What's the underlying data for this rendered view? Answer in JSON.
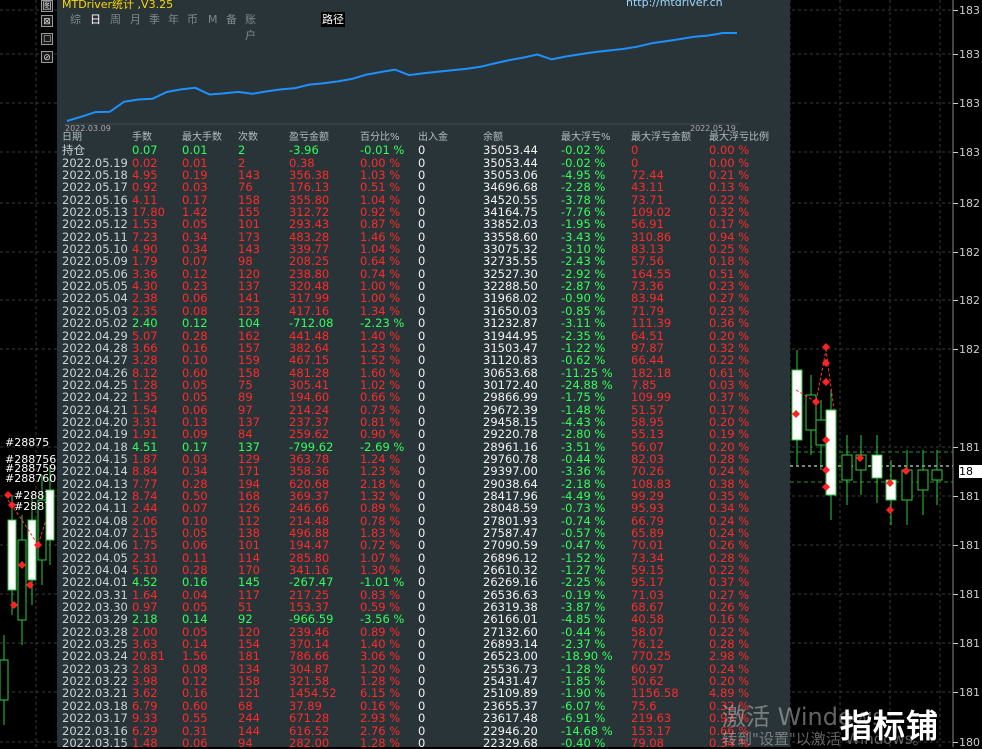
{
  "panel": {
    "title": "MTDriver统计 ,V3.25",
    "url": "http://mtdriver.cn",
    "tabs": [
      "综",
      "日",
      "周",
      "月",
      "季",
      "年",
      "币",
      "M",
      "备",
      "账户"
    ],
    "active_tab": "日",
    "path_button": "路径",
    "side_buttons": [
      "图",
      "⊠",
      "☐",
      "⊘"
    ]
  },
  "curve": {
    "start_date": "2022.03.09",
    "end_date": "2022.05.19",
    "color": "#1e90ff",
    "equity": [
      22329.68,
      22946.2,
      23617.48,
      23655.37,
      25109.89,
      25431.47,
      25536.73,
      26523.0,
      26893.14,
      27132.6,
      26166.01,
      26319.38,
      26536.63,
      26269.16,
      26610.32,
      26896.12,
      27090.59,
      27587.47,
      27801.93,
      28048.59,
      28417.96,
      29038.64,
      29397.0,
      29760.78,
      28961.16,
      29220.78,
      29458.15,
      29672.39,
      29866.99,
      30172.4,
      30653.68,
      31120.83,
      31503.47,
      31944.95,
      31232.87,
      31650.03,
      31968.02,
      32288.5,
      32527.3,
      32735.55,
      33075.32,
      33558.6,
      33852.03,
      34164.75,
      34520.55,
      34696.68,
      35053.06,
      35053.44
    ]
  },
  "table": {
    "headers": [
      "日期",
      "手数",
      "最大手数",
      "次数",
      "盈亏金额",
      "百分比%",
      "出入金",
      "余额",
      "最大浮亏%",
      "最大浮亏金额",
      "最大浮亏比例"
    ],
    "rows": [
      [
        "持仓",
        "0.07",
        "0.01",
        "2",
        "-3.96",
        "-0.01 %",
        "0",
        "35053.44",
        "-0.02 %",
        "0",
        "0.00 %"
      ],
      [
        "2022.05.19",
        "0.02",
        "0.01",
        "2",
        "0.38",
        "0.00 %",
        "0",
        "35053.44",
        "-0.02 %",
        "0",
        "0.00 %"
      ],
      [
        "2022.05.18",
        "4.95",
        "0.19",
        "143",
        "356.38",
        "1.03 %",
        "0",
        "35053.06",
        "-4.95 %",
        "72.44",
        "0.21 %"
      ],
      [
        "2022.05.17",
        "0.92",
        "0.03",
        "76",
        "176.13",
        "0.51 %",
        "0",
        "34696.68",
        "-2.28 %",
        "43.11",
        "0.13 %"
      ],
      [
        "2022.05.16",
        "4.11",
        "0.17",
        "158",
        "355.80",
        "1.04 %",
        "0",
        "34520.55",
        "-3.78 %",
        "73.71",
        "0.22 %"
      ],
      [
        "2022.05.13",
        "17.80",
        "1.42",
        "155",
        "312.72",
        "0.92 %",
        "0",
        "34164.75",
        "-7.76 %",
        "109.02",
        "0.32 %"
      ],
      [
        "2022.05.12",
        "1.53",
        "0.05",
        "101",
        "293.43",
        "0.87 %",
        "0",
        "33852.03",
        "-1.95 %",
        "56.91",
        "0.17 %"
      ],
      [
        "2022.05.11",
        "7.23",
        "0.34",
        "173",
        "483.28",
        "1.46 %",
        "0",
        "33558.60",
        "-3.43 %",
        "310.86",
        "0.94 %"
      ],
      [
        "2022.05.10",
        "4.90",
        "0.34",
        "143",
        "339.77",
        "1.04 %",
        "0",
        "33075.32",
        "-3.10 %",
        "83.13",
        "0.25 %"
      ],
      [
        "2022.05.09",
        "1.79",
        "0.07",
        "98",
        "208.25",
        "0.64 %",
        "0",
        "32735.55",
        "-2.43 %",
        "57.56",
        "0.18 %"
      ],
      [
        "2022.05.06",
        "3.36",
        "0.12",
        "120",
        "238.80",
        "0.74 %",
        "0",
        "32527.30",
        "-2.92 %",
        "164.55",
        "0.51 %"
      ],
      [
        "2022.05.05",
        "4.30",
        "0.23",
        "137",
        "320.48",
        "1.00 %",
        "0",
        "32288.50",
        "-2.87 %",
        "73.36",
        "0.23 %"
      ],
      [
        "2022.05.04",
        "2.38",
        "0.06",
        "141",
        "317.99",
        "1.00 %",
        "0",
        "31968.02",
        "-0.90 %",
        "83.94",
        "0.27 %"
      ],
      [
        "2022.05.03",
        "2.35",
        "0.08",
        "123",
        "417.16",
        "1.34 %",
        "0",
        "31650.03",
        "-0.85 %",
        "71.79",
        "0.23 %"
      ],
      [
        "2022.05.02",
        "2.40",
        "0.12",
        "104",
        "-712.08",
        "-2.23 %",
        "0",
        "31232.87",
        "-3.11 %",
        "111.39",
        "0.36 %"
      ],
      [
        "2022.04.29",
        "5.07",
        "0.28",
        "162",
        "441.48",
        "1.40 %",
        "0",
        "31944.95",
        "-2.35 %",
        "64.51",
        "0.20 %"
      ],
      [
        "2022.04.28",
        "3.66",
        "0.16",
        "157",
        "382.64",
        "1.23 %",
        "0",
        "31503.47",
        "-1.22 %",
        "97.87",
        "0.32 %"
      ],
      [
        "2022.04.27",
        "3.28",
        "0.10",
        "159",
        "467.15",
        "1.52 %",
        "0",
        "31120.83",
        "-0.62 %",
        "66.44",
        "0.22 %"
      ],
      [
        "2022.04.26",
        "8.12",
        "0.60",
        "158",
        "481.28",
        "1.60 %",
        "0",
        "30653.68",
        "-11.25 %",
        "182.18",
        "0.61 %"
      ],
      [
        "2022.04.25",
        "1.28",
        "0.05",
        "75",
        "305.41",
        "1.02 %",
        "0",
        "30172.40",
        "-24.88 %",
        "7.85",
        "0.03 %"
      ],
      [
        "2022.04.22",
        "1.35",
        "0.05",
        "89",
        "194.60",
        "0.66 %",
        "0",
        "29866.99",
        "-1.75 %",
        "109.99",
        "0.37 %"
      ],
      [
        "2022.04.21",
        "1.54",
        "0.06",
        "97",
        "214.24",
        "0.73 %",
        "0",
        "29672.39",
        "-1.48 %",
        "51.57",
        "0.17 %"
      ],
      [
        "2022.04.20",
        "3.31",
        "0.13",
        "137",
        "237.37",
        "0.81 %",
        "0",
        "29458.15",
        "-4.43 %",
        "58.95",
        "0.20 %"
      ],
      [
        "2022.04.19",
        "1.91",
        "0.09",
        "84",
        "259.62",
        "0.90 %",
        "0",
        "29220.78",
        "-2.80 %",
        "55.13",
        "0.19 %"
      ],
      [
        "2022.04.18",
        "4.51",
        "0.17",
        "137",
        "-799.62",
        "-2.69 %",
        "0",
        "28961.16",
        "-3.51 %",
        "56.07",
        "0.20 %"
      ],
      [
        "2022.04.15",
        "1.87",
        "0.03",
        "129",
        "363.78",
        "1.24 %",
        "0",
        "29760.78",
        "-0.44 %",
        "82.03",
        "0.28 %"
      ],
      [
        "2022.04.14",
        "8.84",
        "0.34",
        "171",
        "358.36",
        "1.23 %",
        "0",
        "29397.00",
        "-3.36 %",
        "70.26",
        "0.24 %"
      ],
      [
        "2022.04.13",
        "7.77",
        "0.28",
        "194",
        "620.68",
        "2.18 %",
        "0",
        "29038.64",
        "-2.18 %",
        "108.83",
        "0.38 %"
      ],
      [
        "2022.04.12",
        "8.74",
        "0.50",
        "168",
        "369.37",
        "1.32 %",
        "0",
        "28417.96",
        "-4.49 %",
        "99.29",
        "0.35 %"
      ],
      [
        "2022.04.11",
        "2.44",
        "0.07",
        "126",
        "246.66",
        "0.89 %",
        "0",
        "28048.59",
        "-0.73 %",
        "95.93",
        "0.34 %"
      ],
      [
        "2022.04.08",
        "2.06",
        "0.10",
        "112",
        "214.48",
        "0.78 %",
        "0",
        "27801.93",
        "-0.74 %",
        "66.79",
        "0.24 %"
      ],
      [
        "2022.04.07",
        "2.15",
        "0.05",
        "138",
        "496.88",
        "1.83 %",
        "0",
        "27587.47",
        "-0.57 %",
        "65.89",
        "0.24 %"
      ],
      [
        "2022.04.06",
        "1.75",
        "0.06",
        "101",
        "194.47",
        "0.72 %",
        "0",
        "27090.59",
        "-0.47 %",
        "70.01",
        "0.26 %"
      ],
      [
        "2022.04.05",
        "2.31",
        "0.11",
        "114",
        "285.80",
        "1.07 %",
        "0",
        "26896.12",
        "-1.52 %",
        "73.34",
        "0.28 %"
      ],
      [
        "2022.04.04",
        "5.10",
        "0.28",
        "170",
        "341.16",
        "1.30 %",
        "0",
        "26610.32",
        "-1.27 %",
        "59.15",
        "0.22 %"
      ],
      [
        "2022.04.01",
        "4.52",
        "0.16",
        "145",
        "-267.47",
        "-1.01 %",
        "0",
        "26269.16",
        "-2.25 %",
        "95.17",
        "0.37 %"
      ],
      [
        "2022.03.31",
        "1.64",
        "0.04",
        "117",
        "217.25",
        "0.83 %",
        "0",
        "26536.63",
        "-0.19 %",
        "71.03",
        "0.27 %"
      ],
      [
        "2022.03.30",
        "0.97",
        "0.05",
        "51",
        "153.37",
        "0.59 %",
        "0",
        "26319.38",
        "-3.87 %",
        "68.67",
        "0.26 %"
      ],
      [
        "2022.03.29",
        "2.18",
        "0.14",
        "92",
        "-966.59",
        "-3.56 %",
        "0",
        "26166.01",
        "-4.85 %",
        "40.58",
        "0.16 %"
      ],
      [
        "2022.03.28",
        "2.00",
        "0.05",
        "120",
        "239.46",
        "0.89 %",
        "0",
        "27132.60",
        "-0.44 %",
        "58.07",
        "0.22 %"
      ],
      [
        "2022.03.25",
        "3.63",
        "0.14",
        "154",
        "370.14",
        "1.40 %",
        "0",
        "26893.14",
        "-2.37 %",
        "76.12",
        "0.28 %"
      ],
      [
        "2022.03.24",
        "20.81",
        "1.56",
        "181",
        "786.66",
        "3.06 %",
        "0",
        "26523.00",
        "-18.90 %",
        "770.25",
        "2.98 %"
      ],
      [
        "2022.03.23",
        "2.83",
        "0.08",
        "134",
        "304.87",
        "1.20 %",
        "0",
        "25536.73",
        "-1.28 %",
        "60.97",
        "0.24 %"
      ],
      [
        "2022.03.22",
        "3.98",
        "0.12",
        "158",
        "321.58",
        "1.28 %",
        "0",
        "25431.47",
        "-1.85 %",
        "50.62",
        "0.20 %"
      ],
      [
        "2022.03.21",
        "3.62",
        "0.16",
        "121",
        "1454.52",
        "6.15 %",
        "0",
        "25109.89",
        "-1.90 %",
        "1156.58",
        "4.89 %"
      ],
      [
        "2022.03.18",
        "6.79",
        "0.60",
        "68",
        "37.89",
        "0.16 %",
        "0",
        "23655.37",
        "-6.07 %",
        "75.6",
        "0.32 %"
      ],
      [
        "2022.03.17",
        "9.33",
        "0.55",
        "244",
        "671.28",
        "2.93 %",
        "0",
        "23617.48",
        "-6.91 %",
        "219.63",
        "0.93 %"
      ],
      [
        "2022.03.16",
        "6.29",
        "0.31",
        "144",
        "616.52",
        "2.76 %",
        "0",
        "22946.20",
        "-14.68 %",
        "153.17",
        "0.66 %"
      ],
      [
        "2022.03.15",
        "1.48",
        "0.06",
        "94",
        "282.00",
        "1.28 %",
        "0",
        "22329.68",
        "-0.40 %",
        "79.08",
        "0.34 %"
      ]
    ]
  },
  "chart": {
    "prices": [
      "183",
      "183",
      "183",
      "183",
      "182",
      "182",
      "182",
      "182",
      "181",
      "181",
      "181",
      "181",
      "181",
      "181",
      "180",
      "180"
    ],
    "order_tags": [
      "#28875",
      "#288756",
      "#288759",
      "#288760",
      "#2887",
      "#2887"
    ],
    "last_price_tag": "18"
  },
  "watermark": {
    "line1": "激活 Windows",
    "line2": "转到\"设置\"以激活 Windows。",
    "brand": "指标铺"
  }
}
